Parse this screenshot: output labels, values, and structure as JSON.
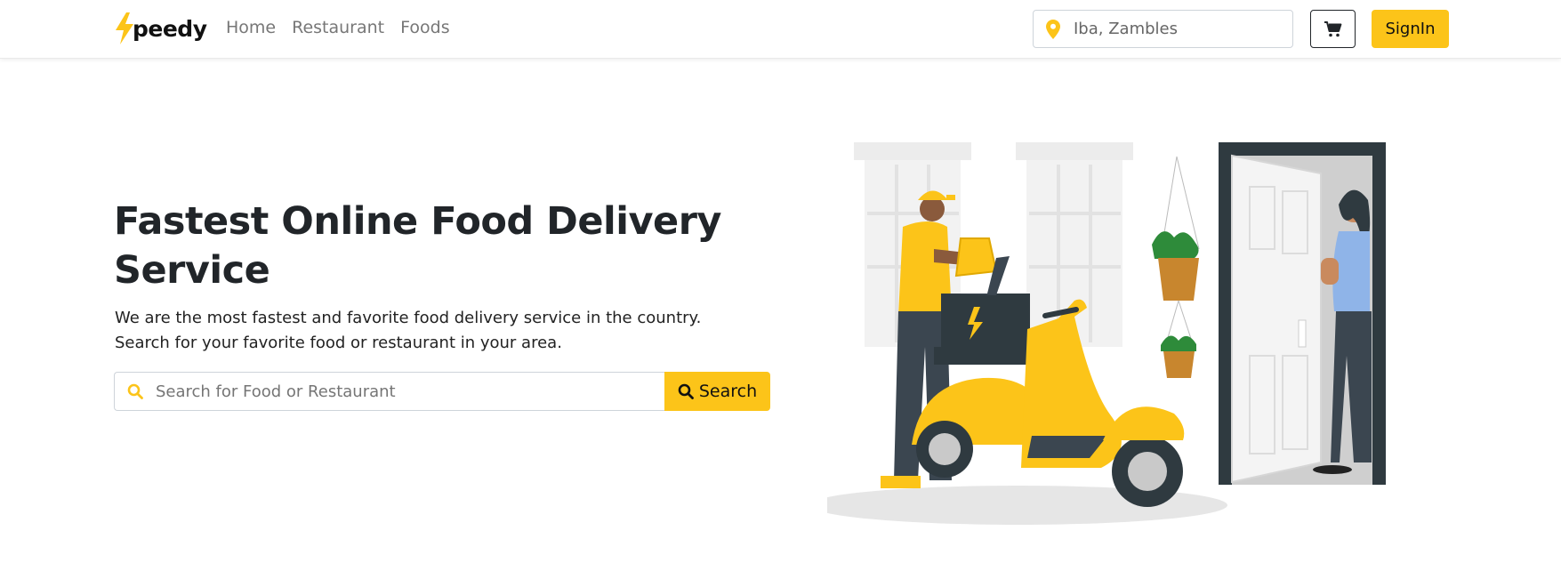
{
  "brand": {
    "name": "peedy",
    "accent": "#fcc419"
  },
  "nav": {
    "links": [
      "Home",
      "Restaurant",
      "Foods"
    ]
  },
  "location": {
    "value": "Iba, Zambles",
    "icon": "map-pin-icon"
  },
  "cart": {
    "icon": "cart-icon"
  },
  "signin": {
    "label": "SignIn"
  },
  "hero": {
    "title": "Fastest Online Food Delivery Service",
    "description_line1": "We are the most fastest and favorite food delivery service in the country.",
    "description_line2": "Search for your favorite food or restaurant in your area."
  },
  "search": {
    "placeholder": "Search for Food or Restaurant",
    "button_label": "Search",
    "icon": "search-icon"
  },
  "colors": {
    "accent": "#fcc419",
    "text": "#212529",
    "muted": "#777777"
  }
}
